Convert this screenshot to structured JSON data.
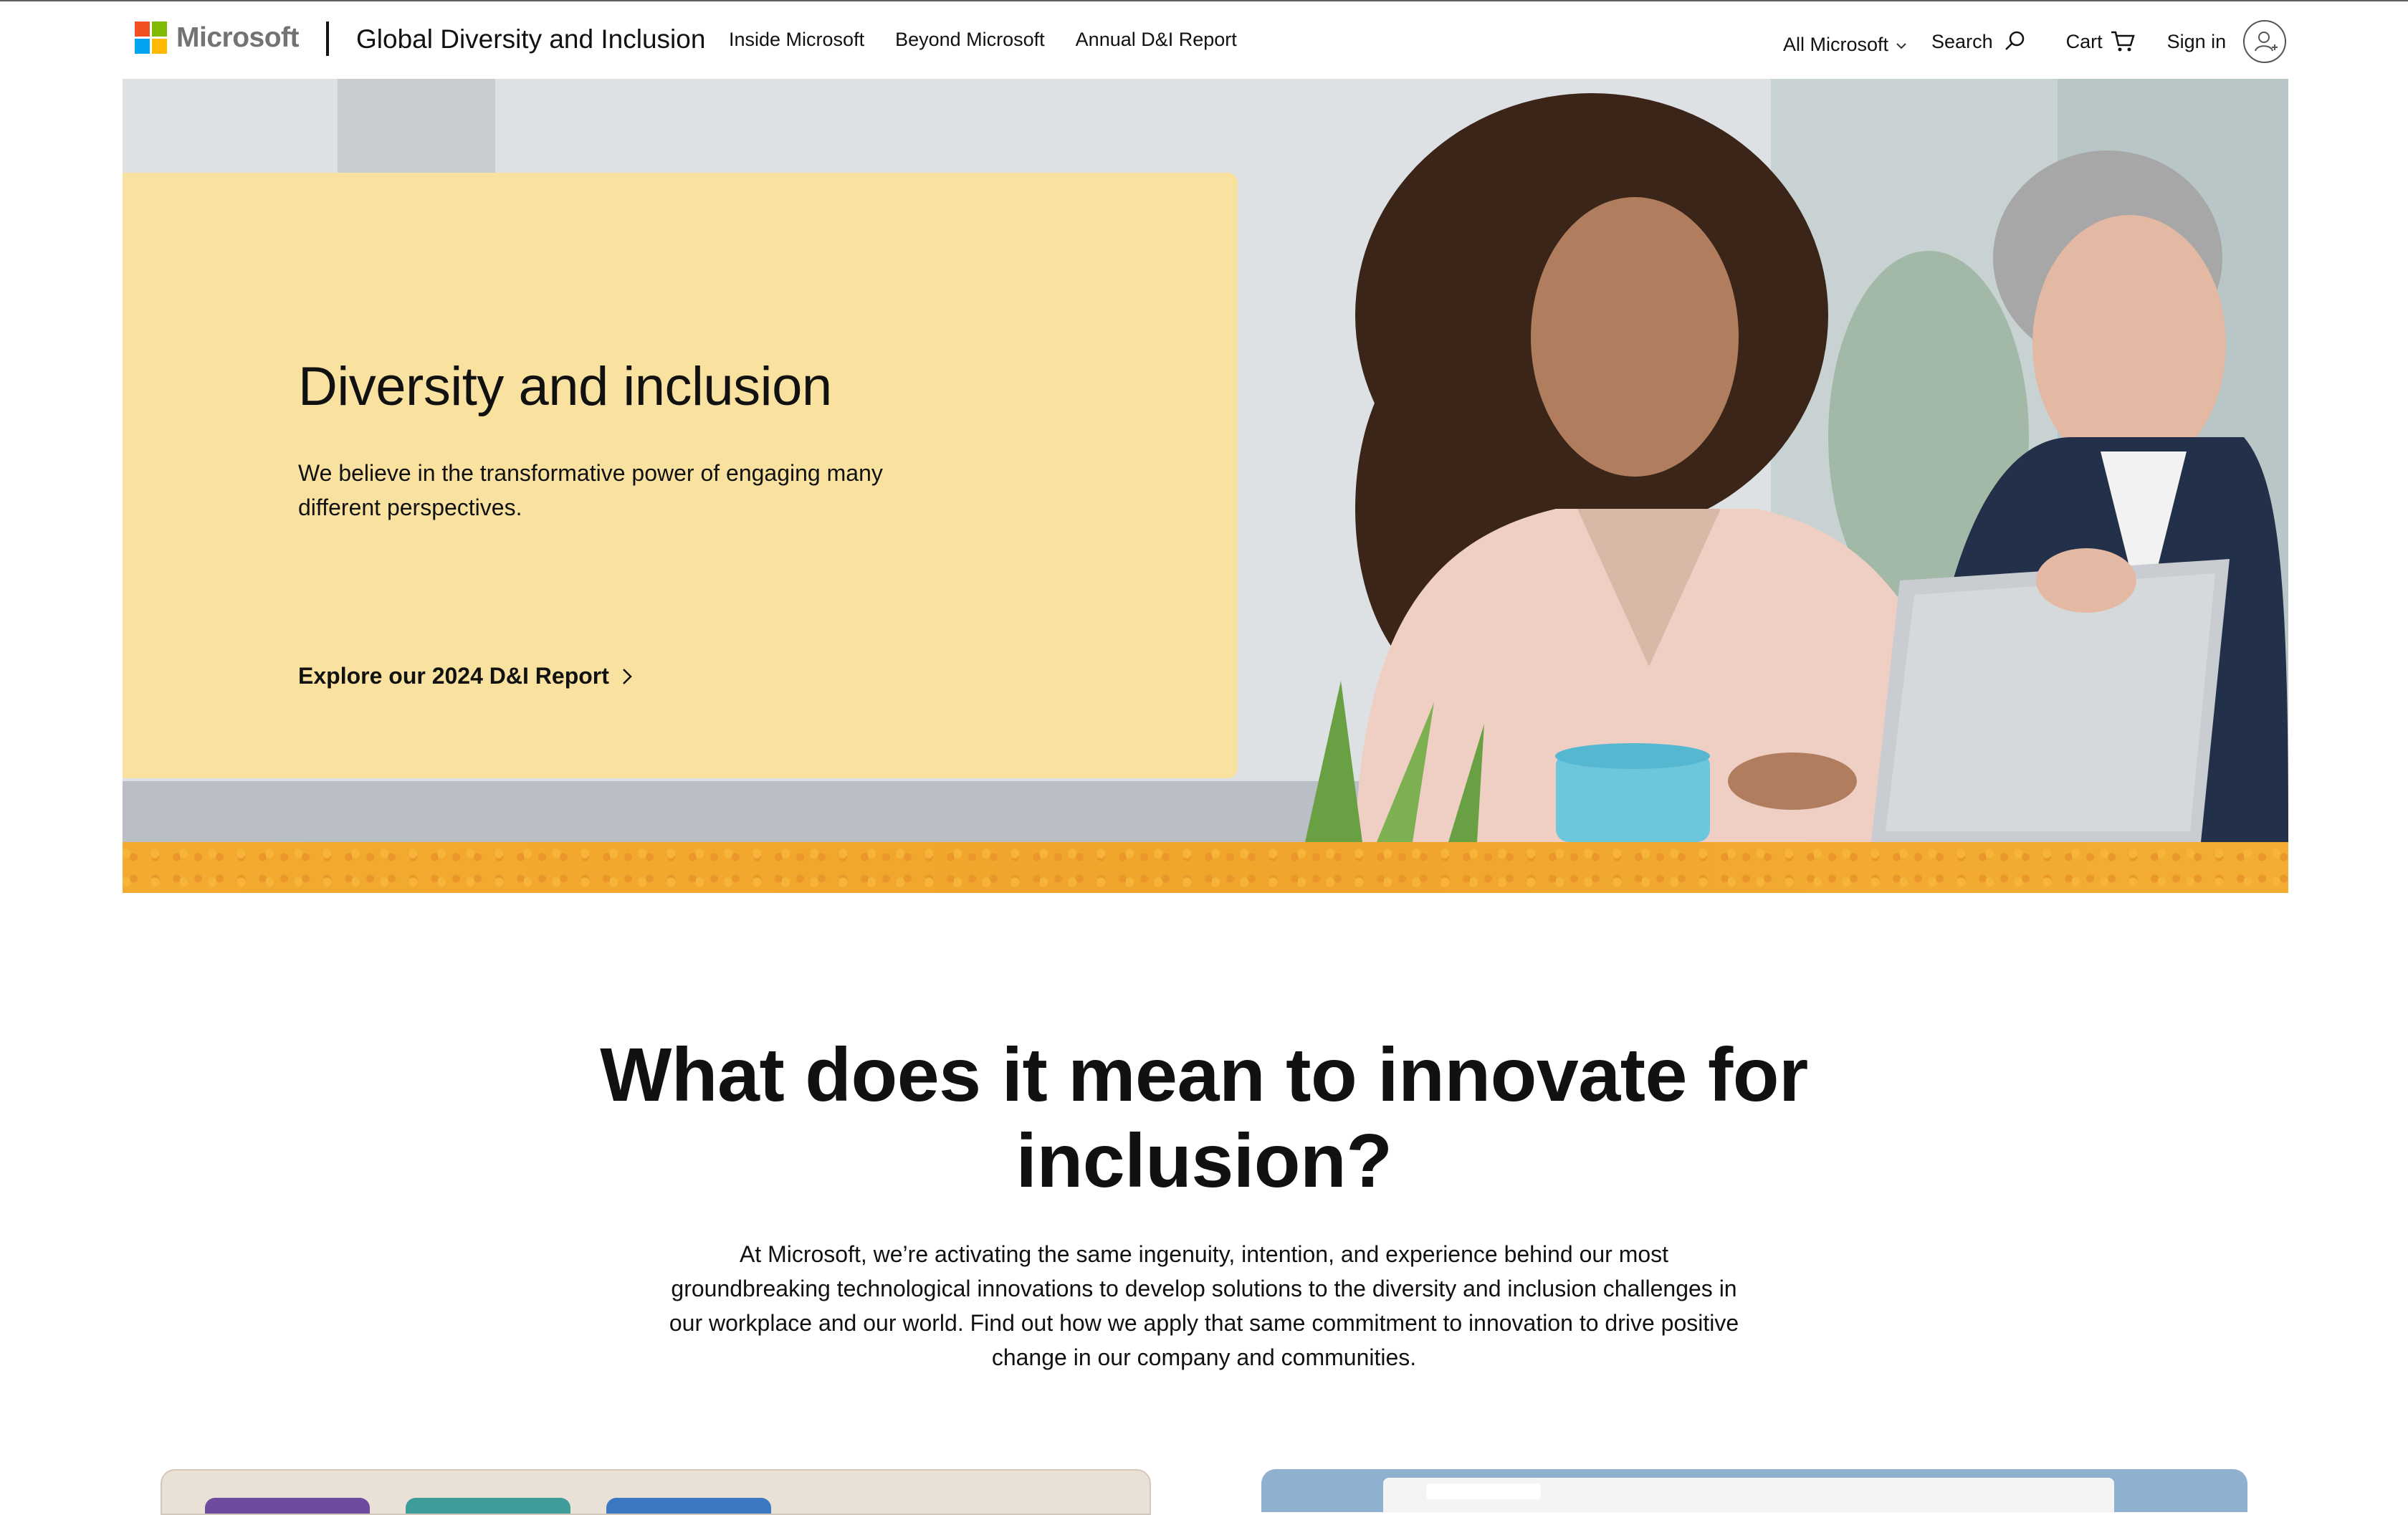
{
  "header": {
    "brand": "Microsoft",
    "site_title": "Global Diversity and Inclusion",
    "nav": [
      "Inside Microsoft",
      "Beyond Microsoft",
      "Annual D&I Report"
    ],
    "all_microsoft": "All Microsoft",
    "search": "Search",
    "cart": "Cart",
    "sign_in": "Sign in"
  },
  "hero": {
    "title": "Diversity and inclusion",
    "subtitle": "We believe in the transformative power of engaging many different perspectives.",
    "cta": "Explore our 2024 D&I Report"
  },
  "section": {
    "title": "What does it mean to innovate for inclusion?",
    "body": "At Microsoft, we’re activating the same ingenuity, intention, and experience behind our most groundbreaking technological innovations to develop solutions to the diversity and inclusion challenges in our workplace and our world. Find out how we apply that same commitment to innovation to drive positive change in our company and communities."
  },
  "colors": {
    "hero_card": "#f9e29f",
    "hero_band": "#f3ab2f",
    "ms_red": "#f25022",
    "ms_green": "#7fba00",
    "ms_blue": "#00a4ef",
    "ms_yellow": "#ffb900"
  }
}
